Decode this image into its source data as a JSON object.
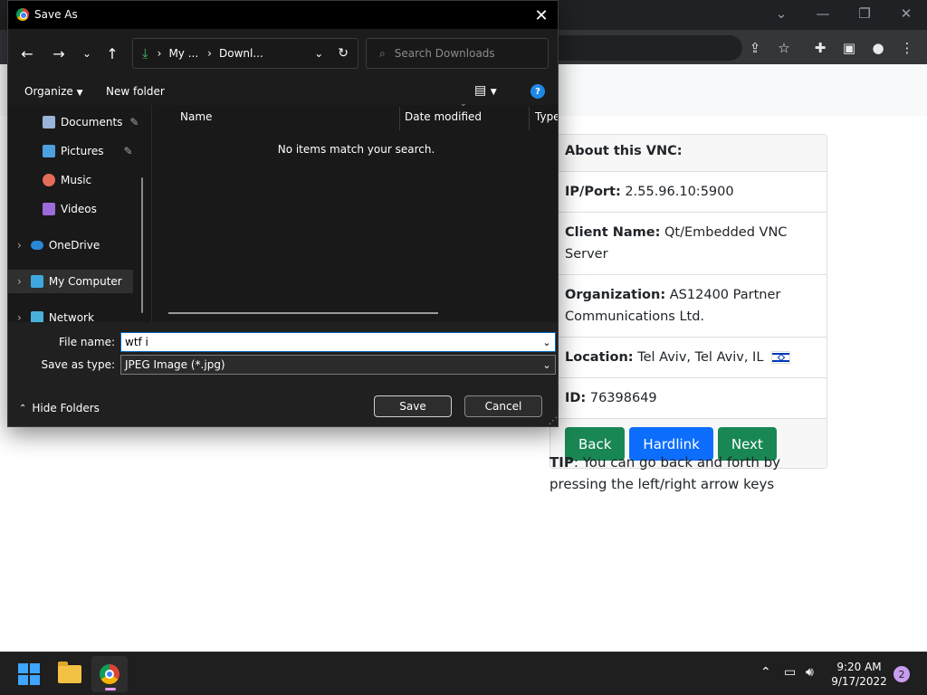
{
  "dialog": {
    "title": "Save As",
    "address": {
      "segment1": "My ...",
      "segment2": "Downl..."
    },
    "search_placeholder": "Search Downloads",
    "commands": {
      "organize": "Organize",
      "new_folder": "New folder"
    },
    "nav_items": [
      {
        "label": "Documents",
        "pinned": true
      },
      {
        "label": "Pictures",
        "pinned": true
      },
      {
        "label": "Music"
      },
      {
        "label": "Videos"
      },
      {
        "label": "OneDrive"
      },
      {
        "label": "My Computer"
      },
      {
        "label": "Network"
      }
    ],
    "columns": [
      "Name",
      "Date modified",
      "Type"
    ],
    "empty_message": "No items match your search.",
    "file_name_label": "File name:",
    "file_name_value": "wtf i",
    "save_type_label": "Save as type:",
    "save_type_value": "JPEG Image (*.jpg)",
    "hide_folders": "Hide Folders",
    "save_button": "Save",
    "cancel_button": "Cancel"
  },
  "vnc": {
    "header": "About this VNC:",
    "rows": [
      {
        "label": "IP/Port:",
        "value": "2.55.96.10:5900"
      },
      {
        "label": "Client Name:",
        "value": "Qt/Embedded VNC Server"
      },
      {
        "label": "Organization:",
        "value": "AS12400 Partner Communications Ltd."
      },
      {
        "label": "Location:",
        "value": "Tel Aviv, Tel Aviv, IL"
      },
      {
        "label": "ID:",
        "value": "76398649"
      }
    ],
    "buttons": {
      "back": "Back",
      "hardlink": "Hardlink",
      "next": "Next"
    },
    "tip_label": "TIP",
    "tip_text": ": You can go back and forth by pressing the left/right arrow keys"
  },
  "taskbar": {
    "time": "9:20 AM",
    "date": "9/17/2022",
    "notification_count": "2"
  },
  "colors": {
    "btn_green": "#198754",
    "btn_blue": "#0d6efd",
    "dialog_bg": "#202020"
  }
}
